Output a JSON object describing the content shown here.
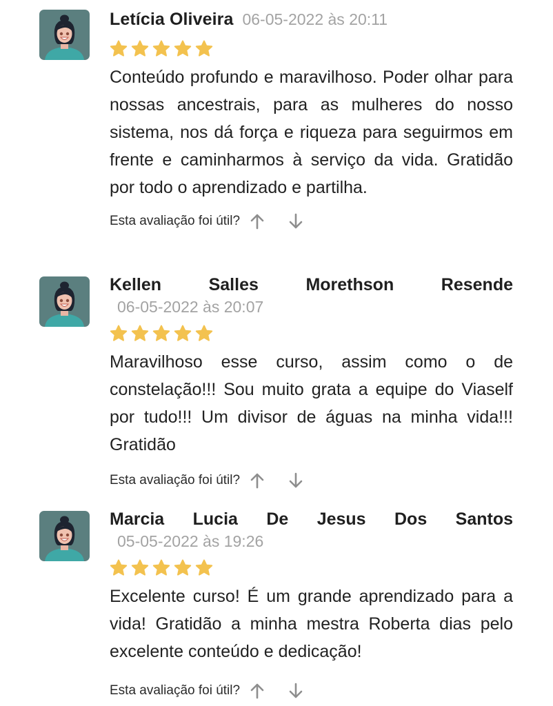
{
  "colors": {
    "star": "#F3C24F",
    "avatar_bg": "#5B7F7F",
    "date": "#A3A3A3",
    "arrow": "#8E8E8E"
  },
  "helpful_prompt": "Esta avaliação foi útil?",
  "reviews": [
    {
      "name": "Letícia Oliveira",
      "date": "06-05-2022 às 20:11",
      "rating": 5,
      "text": "Conteúdo profundo e maravilhoso. Poder olhar para nossas ancestrais, para as mulheres do nosso sistema, nos dá força e riqueza para seguirmos em frente e caminharmos à serviço da vida. Gratidão por todo o aprendizado e partilha."
    },
    {
      "name_words": [
        "Kellen",
        "Salles",
        "Morethson",
        "Resende"
      ],
      "date": "06-05-2022 às 20:07",
      "rating": 5,
      "text": "Maravilhoso esse curso, assim como o de constelação!!! Sou muito grata a equipe do Viaself por tudo!!! Um divisor de águas na minha vida!!! Gratidão"
    },
    {
      "name_words": [
        "Marcia",
        "Lucia",
        "De",
        "Jesus",
        "Dos",
        "Santos"
      ],
      "date": "05-05-2022 às 19:26",
      "rating": 5,
      "text": "Excelente curso! É um grande aprendizado para a vida! Gratidão a minha mestra Roberta dias pelo excelente conteúdo e dedicação!"
    }
  ]
}
